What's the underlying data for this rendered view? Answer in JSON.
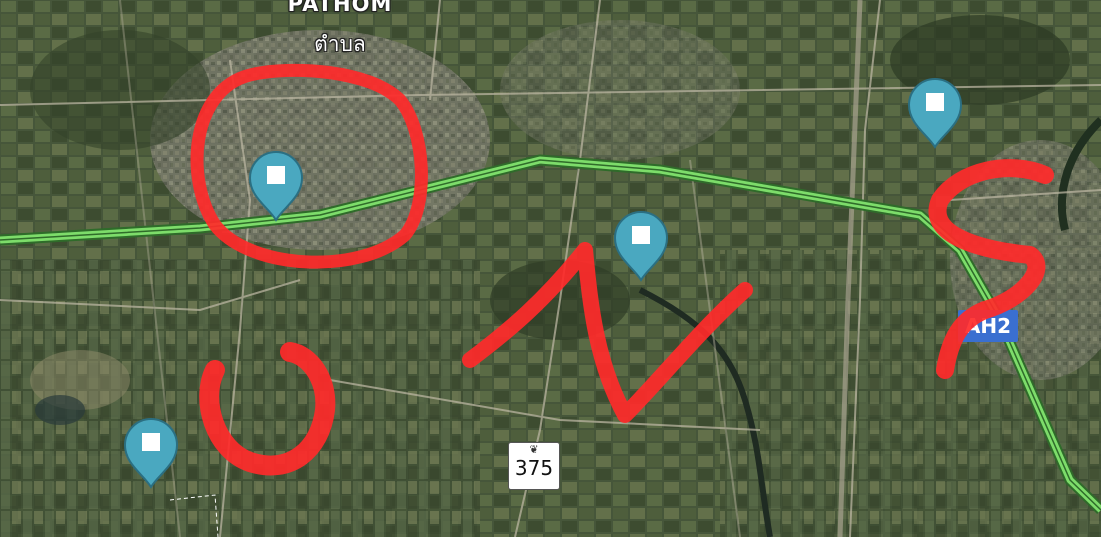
{
  "map": {
    "place_label_en": "PATHOM",
    "place_label_th": "ตำบล",
    "route_shield_number": "375",
    "route_shield_emblem": "❦",
    "highway_badge": "AH2",
    "marker_glyph": "■",
    "colors": {
      "highway_line": "#7ddc6a",
      "highway_outline": "#2f6b2a",
      "marker_fill": "#4aa8c0",
      "marker_stroke": "#2b6f82",
      "annotation_red": "#ff2a2a",
      "badge_blue": "#3a6fd0"
    }
  },
  "markers": [
    {
      "icon": "map-pin-icon"
    },
    {
      "icon": "map-pin-icon"
    },
    {
      "icon": "map-pin-icon"
    },
    {
      "icon": "map-pin-icon"
    }
  ],
  "annotations": [
    "red-circle",
    "red-u-stroke",
    "red-n-stroke",
    "red-s-stroke"
  ]
}
